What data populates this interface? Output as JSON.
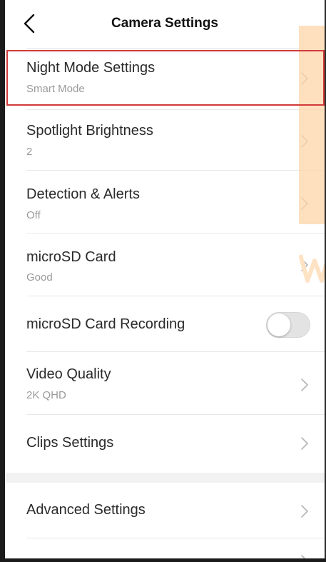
{
  "header": {
    "title": "Camera Settings"
  },
  "rows": [
    {
      "label": "Night Mode Settings",
      "value": "Smart Mode"
    },
    {
      "label": "Spotlight Brightness",
      "value": "2"
    },
    {
      "label": "Detection & Alerts",
      "value": "Off"
    },
    {
      "label": "microSD Card",
      "value": "Good"
    },
    {
      "label": "microSD Card Recording",
      "toggle": false
    },
    {
      "label": "Video Quality",
      "value": "2K QHD"
    },
    {
      "label": "Clips Settings"
    },
    {
      "label": "Advanced Settings"
    }
  ],
  "colors": {
    "highlight": "#d23a3a",
    "overlay": "#fdd6a8",
    "toggle_off": "#e3e3e3"
  },
  "icons": {
    "back": "chevron-left-icon",
    "row_arrow": "chevron-right-icon"
  }
}
